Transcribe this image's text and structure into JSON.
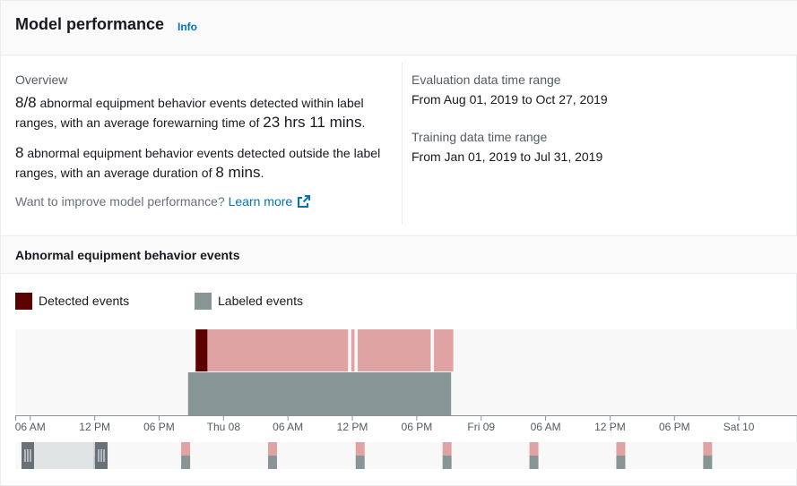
{
  "header": {
    "title": "Model performance",
    "info_label": "Info"
  },
  "overview": {
    "label": "Overview",
    "detected": {
      "count": "8/8",
      "text_a": " abnormal equipment behavior events detected within label ranges, with an average forewarning time of ",
      "time": "23 hrs 11 mins",
      "text_b": "."
    },
    "outside": {
      "count": "8",
      "text_a": " abnormal equipment behavior events detected outside the label ranges, with an average duration of ",
      "time": "8 mins",
      "text_b": "."
    },
    "help_text": "Want to improve model performance? ",
    "learn_more_label": "Learn more",
    "external_icon": "external-link-icon"
  },
  "evaluation": {
    "label": "Evaluation data time range",
    "value": "From Aug 01, 2019 to Oct 27, 2019"
  },
  "training": {
    "label": "Training data time range",
    "value": "From Jan 01, 2019 to Jul 31, 2019"
  },
  "events_section": {
    "title": "Abnormal equipment behavior events"
  },
  "legend": [
    {
      "label": "Detected events",
      "color": "#5d0000"
    },
    {
      "label": "Labeled events",
      "color": "#879596"
    }
  ],
  "colors": {
    "detected_dark": "#5d0000",
    "detected_light": "#e0a3a3",
    "labeled": "#879596",
    "track_bg": "#f8f8f8",
    "link": "#0073bb",
    "handle": "#d5dbdb"
  },
  "timeline": {
    "axis_labels": [
      "06 AM",
      "12 PM",
      "06 PM",
      "Thu 08",
      "06 AM",
      "12 PM",
      "06 PM",
      "Fri 09",
      "06 AM",
      "12 PM",
      "06 PM",
      "Sat 10"
    ],
    "axis_hours": [
      6,
      12,
      18,
      24,
      30,
      36,
      42,
      48,
      54,
      60,
      66,
      72
    ],
    "view_start_hour": 4.6,
    "view_end_hour": 77.5,
    "detected_dark": {
      "start_hour": 21.4,
      "end_hour": 22.5
    },
    "detected_light": [
      {
        "start_hour": 22.5,
        "end_hour": 35.6
      },
      {
        "start_hour": 35.9,
        "end_hour": 36.2
      },
      {
        "start_hour": 36.5,
        "end_hour": 43.3
      },
      {
        "start_hour": 43.6,
        "end_hour": 45.4
      }
    ],
    "labeled": {
      "start_hour": 20.7,
      "end_hour": 45.2
    }
  },
  "overview_strip": {
    "event_positions": [
      0.1,
      0.212,
      0.323,
      0.435,
      0.546,
      0.657,
      0.768,
      0.879
    ],
    "selection": {
      "start": 0.008,
      "end": 0.118
    }
  }
}
